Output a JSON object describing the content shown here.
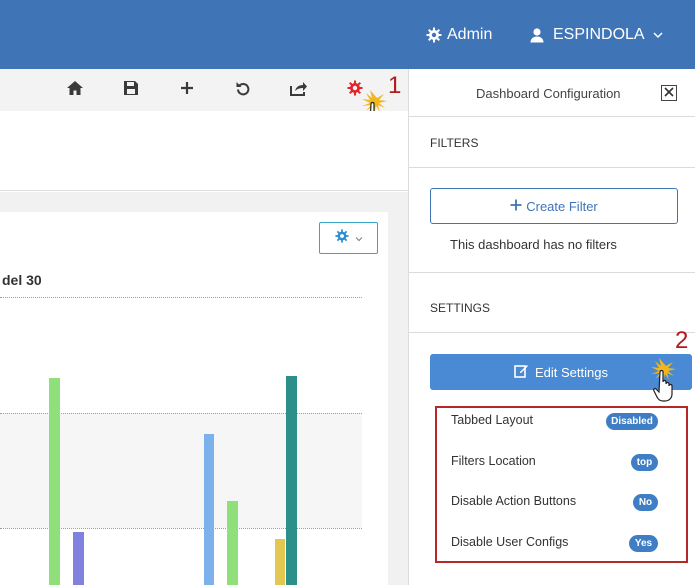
{
  "topbar": {
    "admin_label": "Admin",
    "user_label": "ESPINDOLA"
  },
  "toolbar": {
    "icons": [
      "home-icon",
      "save-icon",
      "plus-icon",
      "undo-icon",
      "share-icon",
      "gear-icon"
    ],
    "annotation_1": "1"
  },
  "widget": {
    "title_fragment": "del 30"
  },
  "panel": {
    "title": "Dashboard Configuration",
    "filters_label": "FILTERS",
    "create_filter_label": "Create Filter",
    "no_filters_text": "This dashboard has no filters",
    "settings_label": "SETTINGS",
    "edit_settings_label": "Edit Settings",
    "annotation_2": "2",
    "settings": [
      {
        "label": "Tabbed Layout",
        "value": "Disabled"
      },
      {
        "label": "Filters Location",
        "value": "top"
      },
      {
        "label": "Disable Action Buttons",
        "value": "No"
      },
      {
        "label": "Disable User Configs",
        "value": "Yes"
      }
    ]
  },
  "colors": {
    "topbar": "#3f74b6",
    "primary_button": "#4a8ad4",
    "gear_red": "#e0262b",
    "annotation_red": "#b01c1c",
    "pill": "#3f7ec4"
  }
}
